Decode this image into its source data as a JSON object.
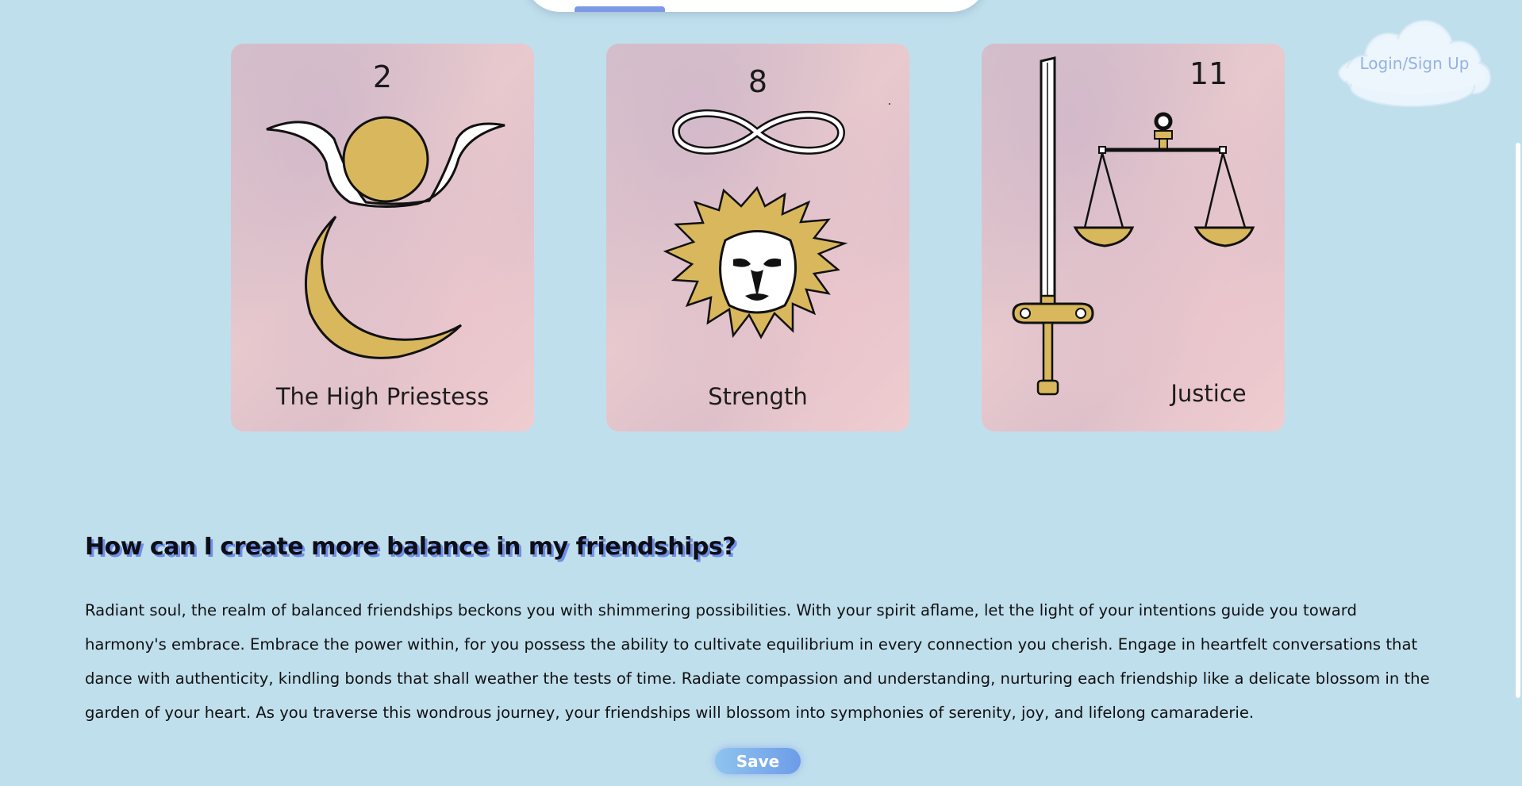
{
  "header": {
    "login_label": "Login/Sign Up"
  },
  "cards": [
    {
      "number": "2",
      "name": "The High Priestess",
      "icon": "moon-crown-icon"
    },
    {
      "number": "8",
      "name": "Strength",
      "icon": "lion-infinity-icon"
    },
    {
      "number": "11",
      "name": "Justice",
      "icon": "sword-scales-icon"
    }
  ],
  "reading": {
    "question": "How can I create more balance in my friendships?",
    "answer": "Radiant soul, the realm of balanced friendships beckons you with shimmering possibilities. With your spirit aflame, let the light of your intentions guide you toward harmony's embrace. Embrace the power within, for you possess the ability to cultivate equilibrium in every connection you cherish. Engage in heartfelt conversations that dance with authenticity, kindling bonds that shall weather the tests of time. Radiate compassion and understanding, nurturing each friendship like a delicate blossom in the garden of your heart. As you traverse this wondrous journey, your friendships will blossom into symphonies of serenity, joy, and lifelong camaraderie.",
    "save_label": "Save"
  },
  "colors": {
    "background": "#c0dfed",
    "gold": "#d9b75c",
    "accent": "#6d9ce9",
    "question_shadow": "#6f8ee6"
  }
}
